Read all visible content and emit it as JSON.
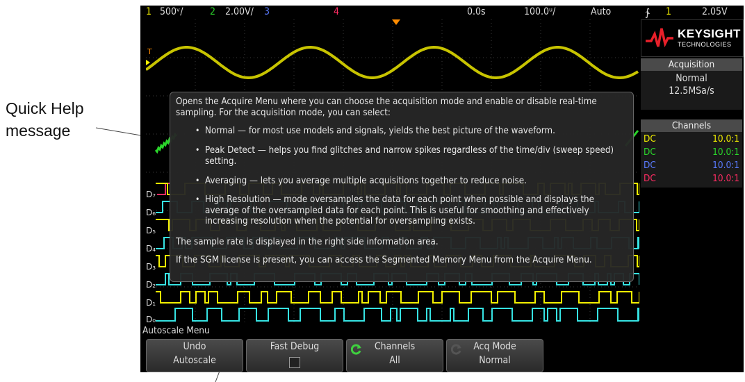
{
  "annotation": {
    "line1": "Quick Help",
    "line2": "message"
  },
  "topbar": {
    "ch1_num": "1",
    "ch1_scale": "500ᵛ/",
    "ch2_num": "2",
    "ch2_scale": "2.00V/",
    "ch3_num": "3",
    "ch4_num": "4",
    "time_delay": "0.0s",
    "time_scale": "100.0ᵘ/",
    "trigger_mode": "Auto",
    "trigger_slope_glyph": "∱",
    "trigger_source": "1",
    "trigger_level": "2.05V"
  },
  "grid": {
    "trigger_marker": "T",
    "channel_labels": [
      "D₇",
      "D₆",
      "D₅",
      "D₄",
      "D₃",
      "D₂",
      "D₁",
      "D₀"
    ]
  },
  "brand": {
    "name": "KEYSIGHT",
    "sub": "TECHNOLOGIES"
  },
  "acquisition": {
    "title": "Acquisition",
    "mode": "Normal",
    "rate": "12.5MSa/s"
  },
  "channels_panel": {
    "title": "Channels",
    "rows": [
      {
        "coupling": "DC",
        "probe": "10.0:1",
        "color": "#f4f000"
      },
      {
        "coupling": "DC",
        "probe": "10.0:1",
        "color": "#2bd62b"
      },
      {
        "coupling": "DC",
        "probe": "10.0:1",
        "color": "#5a7bff"
      },
      {
        "coupling": "DC",
        "probe": "10.0:1",
        "color": "#ff2c63"
      }
    ]
  },
  "quick_help": {
    "intro": "Opens the Acquire Menu where you can choose the acquisition mode and enable or disable real-time sampling. For the acquisition mode, you can select:",
    "bullets": [
      "Normal — for most use models and signals, yields the best picture of the waveform.",
      "Peak Detect — helps you find glitches and narrow spikes regardless of the time/div (sweep speed) setting.",
      "Averaging — lets you average multiple acquisitions together to reduce noise.",
      "High Resolution — mode oversamples the data for each point when possible and displays the average of the oversampled data for each point. This is useful for smoothing and effectively increasing resolution when the potential for oversampling exists."
    ],
    "note1": "The sample rate is displayed in the right side information area.",
    "note2": "If the SGM license is present, you can access the Segmented Memory Menu from the Acquire Menu."
  },
  "softmenu": {
    "title": "Autoscale Menu",
    "keys": [
      {
        "line1": "Undo",
        "line2": "Autoscale"
      },
      {
        "line1": "Fast Debug",
        "line2": ""
      },
      {
        "line1": "Channels",
        "line2": "All"
      },
      {
        "line1": "Acq Mode",
        "line2": "Normal"
      }
    ]
  },
  "colors": {
    "ch1": "#f4f000",
    "ch2": "#2bd62b",
    "ch3": "#5a7bff",
    "ch4": "#ff2c63",
    "digital_cyan": "#36e3e3",
    "trigger_orange": "#ff8c00"
  }
}
